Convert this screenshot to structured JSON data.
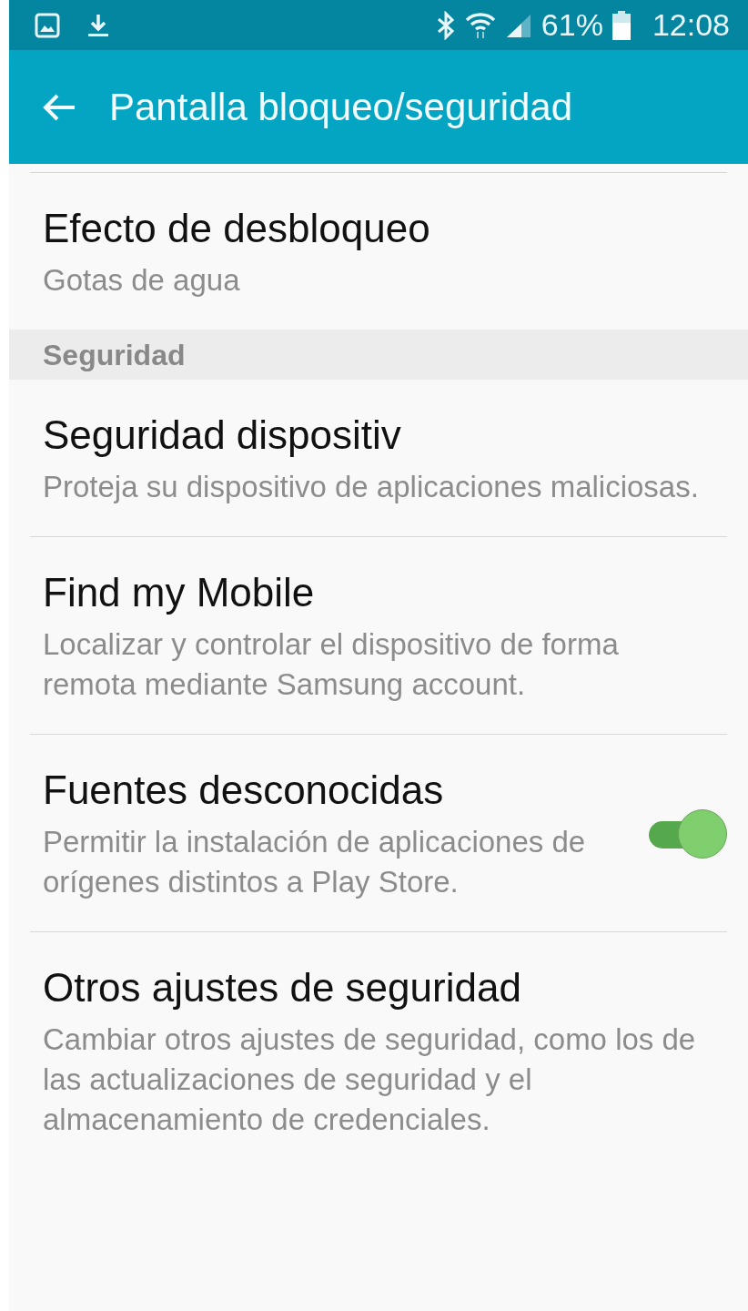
{
  "status_bar": {
    "battery": "61%",
    "time": "12:08"
  },
  "app_bar": {
    "title": "Pantalla bloqueo/seguridad"
  },
  "items": [
    {
      "kind": "item",
      "title": "Efecto de desbloqueo",
      "subtitle": "Gotas de agua"
    },
    {
      "kind": "header",
      "title": "Seguridad"
    },
    {
      "kind": "item",
      "title": "Seguridad dispositiv",
      "subtitle": "Proteja su dispositivo de aplicaciones maliciosas."
    },
    {
      "kind": "item",
      "title": "Find my Mobile",
      "subtitle": "Localizar y controlar el dispositivo de forma remota mediante Samsung account."
    },
    {
      "kind": "toggle",
      "title": "Fuentes desconocidas",
      "subtitle": "Permitir la instalación de aplicaciones de orígenes distintos a Play Store.",
      "on": true
    },
    {
      "kind": "item",
      "title": "Otros ajustes de seguridad",
      "subtitle": "Cambiar otros ajustes de seguridad, como los de las actualizaciones de seguridad y el almacenamiento de credenciales."
    }
  ]
}
